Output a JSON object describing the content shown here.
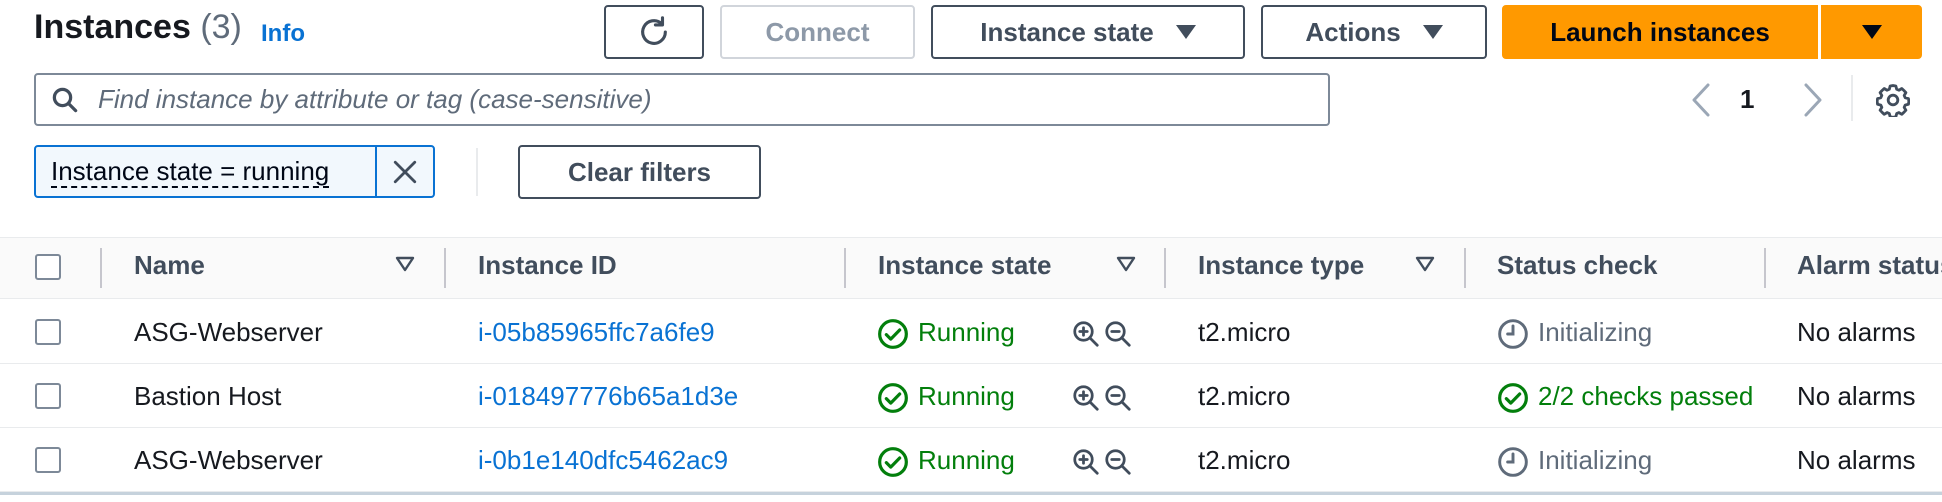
{
  "header": {
    "title": "Instances",
    "count": "(3)",
    "info_link": "Info"
  },
  "toolbar": {
    "connect_label": "Connect",
    "instance_state_label": "Instance state",
    "actions_label": "Actions",
    "launch_label": "Launch instances"
  },
  "search": {
    "placeholder": "Find instance by attribute or tag (case-sensitive)",
    "value": ""
  },
  "pagination": {
    "current_page": "1"
  },
  "filters": {
    "active_token": "Instance state = running",
    "clear_label": "Clear filters"
  },
  "table": {
    "columns": [
      "Name",
      "Instance ID",
      "Instance state",
      "Instance type",
      "Status check",
      "Alarm status"
    ],
    "rows": [
      {
        "name": "ASG-Webserver",
        "instance_id": "i-05b85965ffc7a6fe9",
        "state": "Running",
        "type": "t2.micro",
        "status_check": "Initializing",
        "status_kind": "pending",
        "alarm": "No alarms"
      },
      {
        "name": "Bastion Host",
        "instance_id": "i-018497776b65a1d3e",
        "state": "Running",
        "type": "t2.micro",
        "status_check": "2/2 checks passed",
        "status_kind": "ok",
        "alarm": "No alarms"
      },
      {
        "name": "ASG-Webserver",
        "instance_id": "i-0b1e140dfc5462ac9",
        "state": "Running",
        "type": "t2.micro",
        "status_check": "Initializing",
        "status_kind": "pending",
        "alarm": "No alarms"
      }
    ]
  },
  "colors": {
    "primary": "#ff9900",
    "link": "#0972d3",
    "success": "#037f0c",
    "muted": "#5f6b7a"
  }
}
